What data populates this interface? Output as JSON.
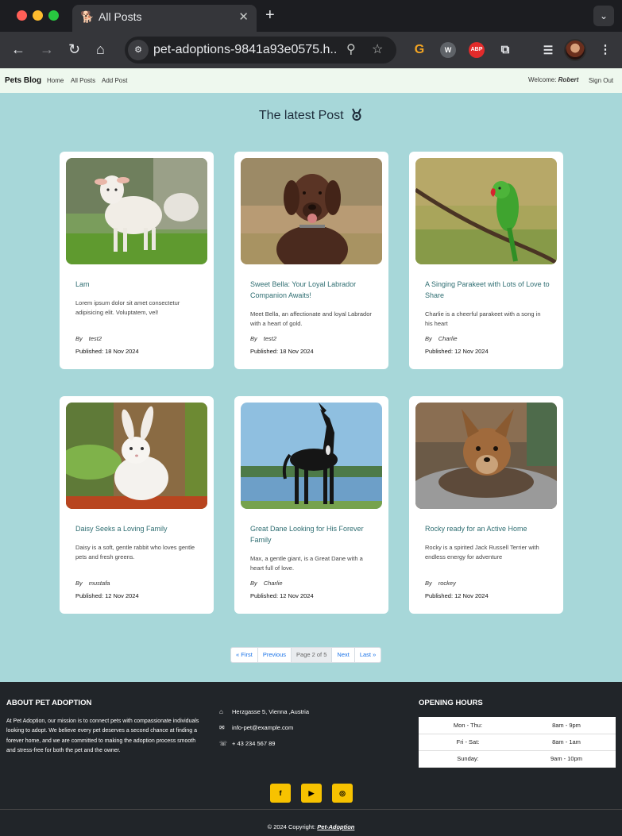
{
  "browser": {
    "tab_title": "All Posts",
    "url": "pet-adoptions-9841a93e0575.h..."
  },
  "navbar": {
    "brand": "Pets Blog",
    "links": [
      "Home",
      "All Posts",
      "Add Post"
    ],
    "welcome_label": "Welcome:",
    "welcome_user": "Robert",
    "sign_out": "Sign Out"
  },
  "section_title": "The latest Post",
  "posts": [
    {
      "title": "Lam",
      "description": "Lorem ipsum dolor sit amet consectetur adipisicing elit. Voluptatem, vel!",
      "by_label": "By",
      "author": "test2",
      "published": "Published: 18 Nov 2024",
      "image": "lamb"
    },
    {
      "title": "Sweet Bella: Your Loyal Labrador Companion Awaits!",
      "description": "Meet Bella, an affectionate and loyal Labrador with a heart of gold.",
      "by_label": "By",
      "author": "test2",
      "published": "Published: 18 Nov 2024",
      "image": "labrador"
    },
    {
      "title": "A Singing Parakeet with Lots of Love to Share",
      "description": "Charlie is a cheerful parakeet with a song in his heart",
      "by_label": "By",
      "author": "Charlie",
      "published": "Published: 12 Nov 2024",
      "image": "parakeet"
    },
    {
      "title": "Daisy Seeks a Loving Family",
      "description": "Daisy is a soft, gentle rabbit who loves gentle pets and fresh greens.",
      "by_label": "By",
      "author": "mustafa",
      "published": "Published: 12 Nov 2024",
      "image": "rabbit"
    },
    {
      "title": "Great Dane Looking for His Forever Family",
      "description": "Max, a gentle giant, is a Great Dane with a heart full of love.",
      "by_label": "By",
      "author": "Charlie",
      "published": "Published: 12 Nov 2024",
      "image": "great-dane"
    },
    {
      "title": "Rocky ready for an Active Home",
      "description": "Rocky is a spirited Jack Russell Terrier with endless energy for adventure",
      "by_label": "By",
      "author": "rockey",
      "published": "Published: 12 Nov 2024",
      "image": "yorkie"
    }
  ],
  "pagination": {
    "first": "« First",
    "previous": "Previous",
    "current": "Page 2 of 5",
    "next": "Next",
    "last": "Last »"
  },
  "footer": {
    "about_heading": "ABOUT PET ADOPTION",
    "about_text": "At Pet Adoption, our mission is to connect pets with compassionate individuals looking to adopt. We believe every pet deserves a second chance at finding a forever home, and we are committed to making the adoption process smooth and stress-free for both the pet and the owner.",
    "address": "Herzgasse 5, Vienna ,Austria",
    "email": "info-pet@example.com",
    "phone": "+ 43 234 567 89",
    "hours_heading": "OPENING HOURS",
    "hours": [
      {
        "day": "Mon - Thu:",
        "time": "8am - 9pm"
      },
      {
        "day": "Fri - Sat:",
        "time": "8am - 1am"
      },
      {
        "day": "Sunday:",
        "time": "9am - 10pm"
      }
    ],
    "copyright_prefix": "© 2024 Copyright:",
    "copyright_link": "Pet-Adoption"
  },
  "colors": {
    "page_background": "#a7d7d9",
    "navbar_background": "#eef8ee",
    "card_title": "#2f6e72",
    "footer_background": "#212529",
    "social_button": "#f7c200"
  },
  "icons": [
    "back-arrow-icon",
    "forward-arrow-icon",
    "reload-icon",
    "home-icon",
    "zoom-icon",
    "star-icon",
    "medal-icon",
    "home-address-icon",
    "mail-icon",
    "phone-icon",
    "facebook-icon",
    "youtube-icon",
    "instagram-icon"
  ]
}
